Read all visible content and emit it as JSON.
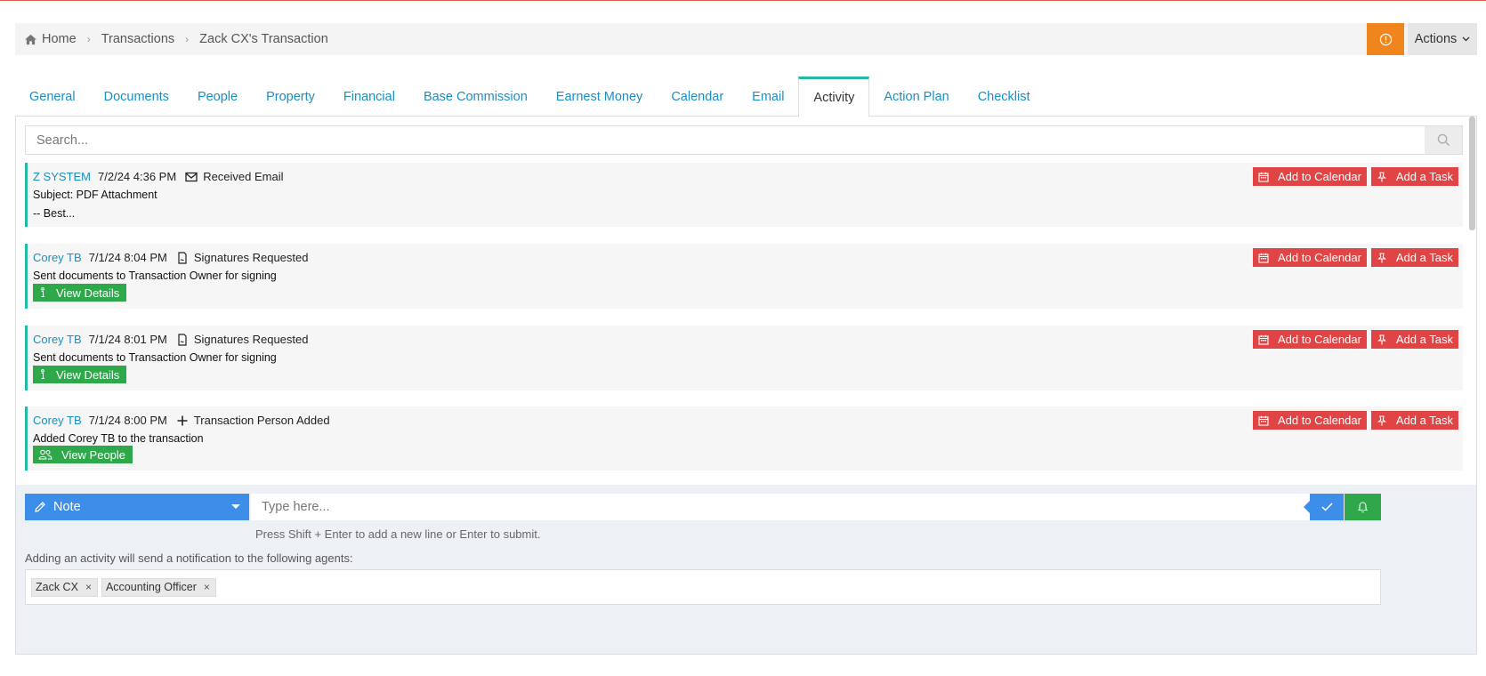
{
  "breadcrumb": {
    "items": [
      "Home",
      "Transactions",
      "Zack CX's Transaction"
    ]
  },
  "header": {
    "actions_label": "Actions",
    "warn_color": "#f0851e"
  },
  "tabs": [
    {
      "label": "General"
    },
    {
      "label": "Documents"
    },
    {
      "label": "People"
    },
    {
      "label": "Property"
    },
    {
      "label": "Financial"
    },
    {
      "label": "Base Commission"
    },
    {
      "label": "Earnest Money"
    },
    {
      "label": "Calendar"
    },
    {
      "label": "Email"
    },
    {
      "label": "Activity",
      "active": true
    },
    {
      "label": "Action Plan"
    },
    {
      "label": "Checklist"
    }
  ],
  "search": {
    "placeholder": "Search..."
  },
  "activities": [
    {
      "author": "Z SYSTEM",
      "time": "7/2/24 4:36 PM",
      "type": "Received Email",
      "type_icon": "envelope-icon",
      "lines": [
        "Subject: PDF Attachment",
        "-- Best..."
      ]
    },
    {
      "author": "Corey TB",
      "time": "7/1/24 8:04 PM",
      "type": "Signatures Requested",
      "type_icon": "document-icon",
      "lines": [
        "Sent documents to Transaction Owner for signing"
      ],
      "button": "View Details",
      "button_icon": "info-icon"
    },
    {
      "author": "Corey TB",
      "time": "7/1/24 8:01 PM",
      "type": "Signatures Requested",
      "type_icon": "document-icon",
      "lines": [
        "Sent documents to Transaction Owner for signing"
      ],
      "button": "View Details",
      "button_icon": "info-icon"
    },
    {
      "author": "Corey TB",
      "time": "7/1/24 8:00 PM",
      "type": "Transaction Person Added",
      "type_icon": "plus-icon",
      "lines": [
        "Added Corey TB to the transaction"
      ],
      "button": "View People",
      "button_icon": "people-icon"
    }
  ],
  "activity_buttons": {
    "calendar": "Add to Calendar",
    "task": "Add a Task"
  },
  "composer": {
    "type_label": "Note",
    "placeholder": "Type here...",
    "hint": "Press Shift + Enter to add a new line or Enter to submit.",
    "notify_label": "Adding an activity will send a notification to the following agents:",
    "agents": [
      "Zack CX",
      "Accounting Officer"
    ]
  },
  "colors": {
    "accent": "#26b9a5",
    "link": "#1a8fc4",
    "danger": "#e04444",
    "success": "#2ea84a",
    "primary": "#3c8ee8"
  }
}
